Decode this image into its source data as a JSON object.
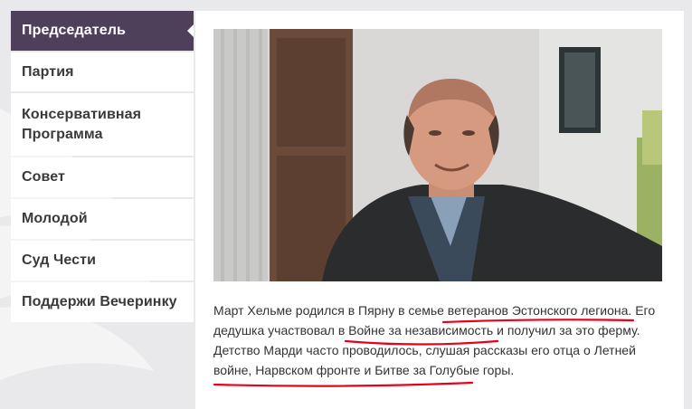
{
  "sidebar": {
    "items": [
      {
        "label": "Председатель",
        "active": true
      },
      {
        "label": "Партия"
      },
      {
        "label": "Консервативная Программа"
      },
      {
        "label": "Совет"
      },
      {
        "label": "Молодой"
      },
      {
        "label": "Суд Чести"
      },
      {
        "label": "Поддержи Вечеринку"
      }
    ]
  },
  "article": {
    "photo_icon": "portrait-photo",
    "bio": {
      "p1": "Март Хельме родился в Пярну в семье ",
      "h1": "ветеранов Эстонского легиона",
      "p2": ". Его дедушка участвовал в ",
      "h2": "Войне за независимость",
      "p3": " и получил за это ферму. Детство Марди часто проводилось, слушая рассказы его отца о Летней войне, ",
      "h3": "Нарвском фронте и Битве за Голубые горы",
      "p4": "."
    }
  },
  "colors": {
    "accent": "#4e3f5b",
    "background": "#e9e9eb",
    "annotation": "#e8001c"
  }
}
